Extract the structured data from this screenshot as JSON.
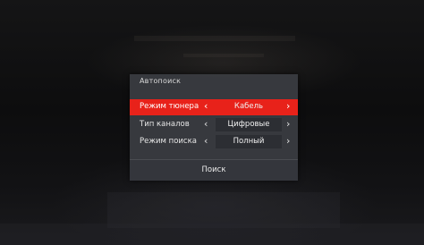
{
  "dialog": {
    "title": "Автопоиск",
    "rows": [
      {
        "label": "Режим тюнера",
        "value": "Кабель",
        "active": true
      },
      {
        "label": "Тип каналов",
        "value": "Цифровые",
        "active": false
      },
      {
        "label": "Режим поиска",
        "value": "Полный",
        "active": false
      }
    ],
    "arrow_left": "‹",
    "arrow_right": "›",
    "search_label": "Поиск"
  },
  "colors": {
    "highlight": "#e8221a",
    "panel": "#3a3c42",
    "background": "#0a0a0b"
  },
  "icons": [
    "chevron-left-icon",
    "chevron-right-icon"
  ]
}
